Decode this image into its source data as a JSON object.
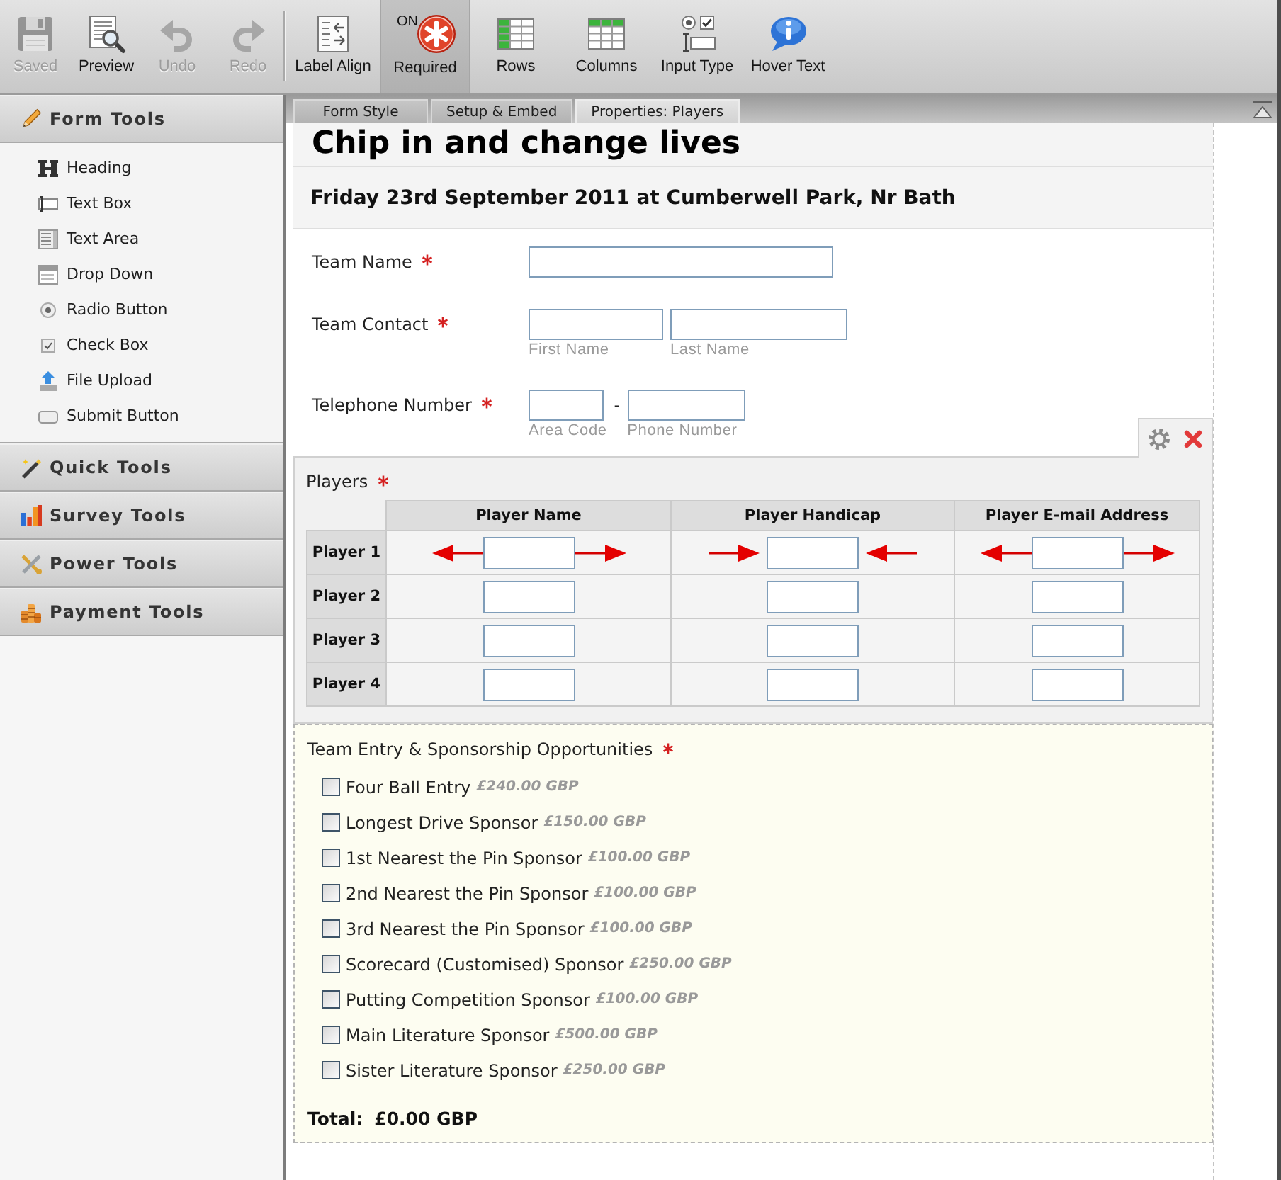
{
  "toolbar": {
    "items": [
      {
        "kind": "save",
        "label": "Saved",
        "disabled": true
      },
      {
        "kind": "preview",
        "label": "Preview",
        "disabled": false
      },
      {
        "kind": "undo",
        "label": "Undo",
        "disabled": true
      },
      {
        "kind": "redo",
        "label": "Redo",
        "disabled": true
      },
      {
        "kind": "separator"
      },
      {
        "kind": "label-align",
        "label": "Label Align",
        "disabled": false
      },
      {
        "kind": "required",
        "label": "Required",
        "disabled": false,
        "on": true,
        "indicator": "ON"
      },
      {
        "kind": "rows",
        "label": "Rows",
        "disabled": false
      },
      {
        "kind": "columns",
        "label": "Columns",
        "disabled": false
      },
      {
        "kind": "input-type",
        "label": "Input Type",
        "disabled": false
      },
      {
        "kind": "hover-text",
        "label": "Hover Text",
        "disabled": false
      }
    ]
  },
  "sidebar": {
    "sections": [
      {
        "kind": "form",
        "title": "Form Tools",
        "items": [
          {
            "kind": "heading",
            "label": "Heading"
          },
          {
            "kind": "text-box",
            "label": "Text Box"
          },
          {
            "kind": "text-area",
            "label": "Text Area"
          },
          {
            "kind": "drop-down",
            "label": "Drop Down"
          },
          {
            "kind": "radio-button",
            "label": "Radio Button"
          },
          {
            "kind": "check-box",
            "label": "Check Box"
          },
          {
            "kind": "file-upload",
            "label": "File Upload"
          },
          {
            "kind": "submit-button",
            "label": "Submit Button"
          }
        ]
      },
      {
        "kind": "quick",
        "title": "Quick Tools"
      },
      {
        "kind": "survey",
        "title": "Survey Tools"
      },
      {
        "kind": "power",
        "title": "Power Tools"
      },
      {
        "kind": "payment",
        "title": "Payment Tools"
      }
    ]
  },
  "tabs": [
    {
      "label": "Form Style",
      "selected": false
    },
    {
      "label": "Setup & Embed",
      "selected": false
    },
    {
      "label": "Properties: Players",
      "selected": true
    }
  ],
  "form": {
    "heading": "Chip in and change lives",
    "subheading": "Friday 23rd September 2011 at Cumberwell Park, Nr Bath",
    "fields": [
      {
        "kind": "textbox",
        "label": "Team Name",
        "required": true,
        "selected": false
      },
      {
        "kind": "fullname",
        "label": "Team Contact",
        "required": true,
        "selected": false,
        "sublabels": [
          "First Name",
          "Last Name"
        ]
      },
      {
        "kind": "phone",
        "label": "Telephone Number",
        "required": true,
        "selected": false,
        "separator": "-",
        "sublabels": [
          "Area Code",
          "Phone Number"
        ]
      },
      {
        "kind": "matrix",
        "label": "Players",
        "required": true,
        "selected": true,
        "columns": [
          {
            "kind": "outward",
            "label": "Player Name"
          },
          {
            "kind": "inward",
            "label": "Player Handicap"
          },
          {
            "kind": "outward",
            "label": "Player E-mail Address"
          }
        ],
        "rows": [
          "Player 1",
          "Player 2",
          "Player 3",
          "Player 4"
        ]
      },
      {
        "kind": "payment",
        "label": "Team Entry & Sponsorship Opportunities",
        "required": true,
        "selected": false,
        "options": [
          {
            "label": "Four Ball Entry",
            "price": "£240.00 GBP",
            "checked": false
          },
          {
            "label": "Longest Drive Sponsor",
            "price": "£150.00 GBP",
            "checked": false
          },
          {
            "label": "1st Nearest the Pin Sponsor",
            "price": "£100.00 GBP",
            "checked": false
          },
          {
            "label": "2nd Nearest the Pin Sponsor",
            "price": "£100.00 GBP",
            "checked": false
          },
          {
            "label": "3rd Nearest the Pin Sponsor",
            "price": "£100.00 GBP",
            "checked": false
          },
          {
            "label": "Scorecard (Customised) Sponsor",
            "price": "£250.00 GBP",
            "checked": false
          },
          {
            "label": "Putting Competition Sponsor",
            "price": "£100.00 GBP",
            "checked": false
          },
          {
            "label": "Main Literature Sponsor",
            "price": "£500.00 GBP",
            "checked": false
          },
          {
            "label": "Sister Literature Sponsor",
            "price": "£250.00 GBP",
            "checked": false
          }
        ],
        "total_label": "Total:",
        "total": "£0.00 GBP"
      }
    ]
  }
}
